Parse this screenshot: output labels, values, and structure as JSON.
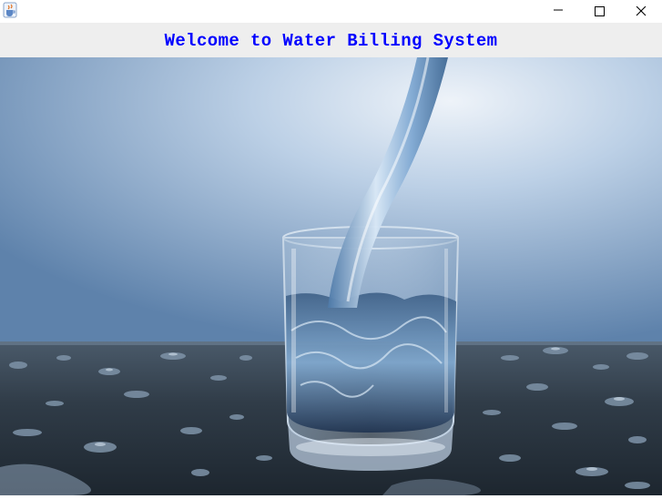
{
  "window": {
    "title": "",
    "controls": [
      {
        "name": "minimize",
        "icon": "minimize-icon"
      },
      {
        "name": "maximize",
        "icon": "maximize-icon"
      },
      {
        "name": "close",
        "icon": "close-icon"
      }
    ],
    "app_icon": "java-cup-icon"
  },
  "header": {
    "title": "Welcome to Water Billing System",
    "color": "#0000ff"
  },
  "background": {
    "subject": "water pouring into glass",
    "colors": {
      "wall_light": "#c9d9ea",
      "wall_dark": "#5b7fa6",
      "table_dark": "#2f3b47",
      "water": "#6fa0cf"
    }
  }
}
